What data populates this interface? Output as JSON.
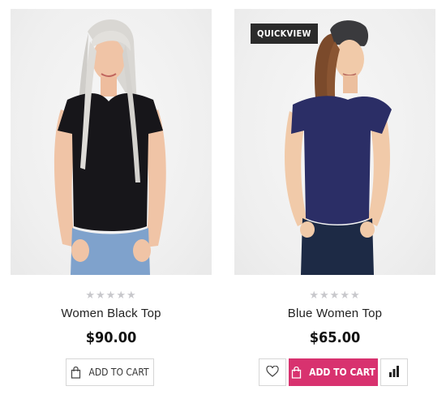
{
  "products": [
    {
      "name": "Women Black Top",
      "price": "$90.00",
      "rating_stars": "★★★★★",
      "rating": 0,
      "add_to_cart_label": "ADD TO CART",
      "image_icon": "woman-black-top-photo"
    },
    {
      "name": "Blue Women Top",
      "price": "$65.00",
      "rating_stars": "★★★★★",
      "rating": 0,
      "add_to_cart_label": "ADD TO CART",
      "quickview_label": "QUICKVIEW",
      "image_icon": "woman-blue-top-photo",
      "wishlist_icon": "heart-icon",
      "compare_icon": "bar-chart-icon"
    }
  ],
  "colors": {
    "accent": "#d8326f",
    "star_empty": "#c8c8cc",
    "quickview_bg": "#2b2b2b"
  }
}
